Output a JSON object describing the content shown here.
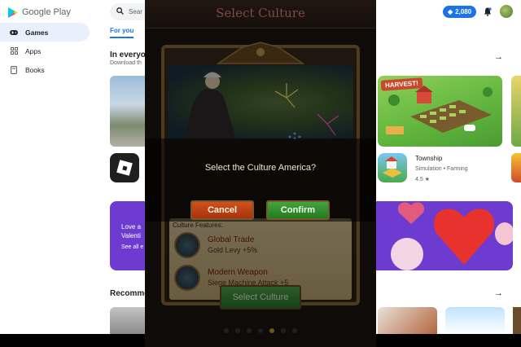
{
  "play": {
    "brand": "Google Play",
    "sidebar": [
      {
        "label": "Games",
        "icon": "gamepad-icon",
        "active": true
      },
      {
        "label": "Apps",
        "icon": "apps-grid-icon",
        "active": false
      },
      {
        "label": "Books",
        "icon": "book-icon",
        "active": false
      }
    ],
    "search_placeholder": "Sear",
    "points": "2,080",
    "tabs": {
      "for_you": "For you",
      "partial": "s"
    },
    "section1": {
      "title": "In everyo",
      "subtitle": "Download th"
    },
    "township": {
      "banner_label": "HARVEST!",
      "name": "Township",
      "genre": "Simulation • Farming",
      "rating": "4.5 ★"
    },
    "promo": {
      "line1": "Love a",
      "line2": "Valenti",
      "line3": "See all e"
    },
    "section2": {
      "title": "Recomme"
    },
    "arrow": "→"
  },
  "game": {
    "title": "Select Culture",
    "confirm_question": "Select the Culture America?",
    "cancel_label": "Cancel",
    "confirm_label": "Confirm",
    "features_heading": "Culture Features:",
    "features": [
      {
        "name": "Global Trade",
        "detail": "Gold Levy +5%"
      },
      {
        "name": "Modern Weapon",
        "detail": "Siege Machine Attack +5"
      }
    ],
    "select_button": "Select Culture",
    "page_dots": 7,
    "active_dot": 4
  },
  "colors": {
    "accent": "#1a73e8",
    "promo": "#6e3bd1",
    "cancel": "#c04418",
    "confirm": "#36902f"
  }
}
